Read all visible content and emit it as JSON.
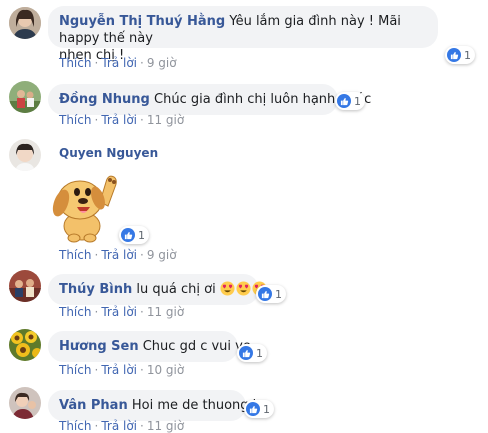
{
  "actions": {
    "like_label": "Thích",
    "reply_label": "Trả lời",
    "separator": "·"
  },
  "colors": {
    "name": "#385898",
    "bubble": "#f2f3f5",
    "like_blue": "#3578e5",
    "meta": "#90949c"
  },
  "comments": [
    {
      "name": "Nguyễn Thị Thuý Hằng",
      "line1": "Yêu lắm gia đình này ! Mãi happy thế này",
      "line2": "nhen chị !",
      "likes": "1",
      "time": "9 giờ",
      "avatar_icon": "woman-avatar"
    },
    {
      "name": "Đồng Nhung",
      "text": "Chúc gia đình chị luôn hạnh phúc",
      "likes": "1",
      "time": "11 giờ",
      "avatar_icon": "family-avatar"
    },
    {
      "name": "Quyen Nguyen",
      "sticker": "waving-dog-sticker",
      "likes": "1",
      "time": "9 giờ",
      "avatar_icon": "girl-avatar"
    },
    {
      "name": "Thúy Bình",
      "text": "lu quá chị ơi",
      "emojis": "😍😍😍",
      "likes": "1",
      "time": "11 giờ",
      "avatar_icon": "group-avatar"
    },
    {
      "name": "Hương Sen",
      "text": "Chuc gd c vui ve",
      "likes": "1",
      "time": "10 giờ",
      "avatar_icon": "sunflower-avatar"
    },
    {
      "name": "Vân Phan",
      "text": "Hoi me de thuong he",
      "likes": "1",
      "time": "11 giờ",
      "avatar_icon": "portrait-avatar"
    }
  ]
}
